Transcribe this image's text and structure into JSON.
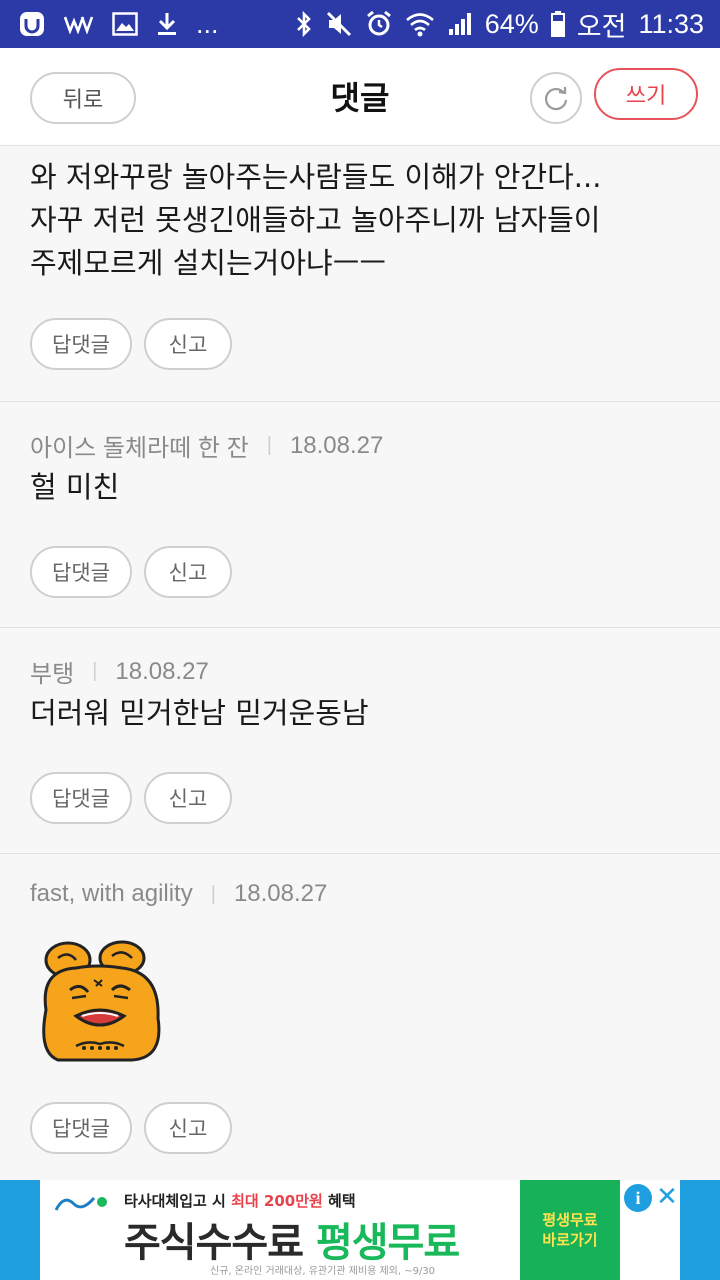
{
  "status_bar": {
    "battery": "64%",
    "ampm": "오전",
    "time": "11:33",
    "ellipsis": "..."
  },
  "header": {
    "back_label": "뒤로",
    "title": "댓글",
    "write_label": "쓰기"
  },
  "comments": [
    {
      "text_lines": [
        "와 저와꾸랑 놀아주는사람들도 이해가 안간다...",
        "자꾸 저런 못생긴애들하고 놀아주니까 남자들이",
        "주제모르게 설치는거아냐ㅡㅡ"
      ],
      "reply_label": "답댓글",
      "report_label": "신고"
    },
    {
      "author": "아이스 돌체라떼 한 잔",
      "date": "18.08.27",
      "text": "헐 미친",
      "reply_label": "답댓글",
      "report_label": "신고"
    },
    {
      "author": "부탱",
      "date": "18.08.27",
      "text": "더러워 믿거한남 믿거운동남",
      "reply_label": "답댓글",
      "report_label": "신고"
    },
    {
      "author": "fast, with agility",
      "date": "18.08.27",
      "reply_label": "답댓글",
      "report_label": "신고"
    }
  ],
  "ad": {
    "top_text_1": "타사대체입고 시",
    "top_text_2": "최대 200만원",
    "top_text_3": "혜택",
    "main_1": "주식수수료",
    "main_2": "평생무료",
    "cta_1": "평생무료",
    "cta_2": "바로가기",
    "fine_print": "신규, 온라인 거래대상, 유관기관 제비용 제외, ~9/30",
    "info_icon": "i",
    "close_icon": "✕"
  },
  "colors": {
    "status_bar": "#2b3aa7",
    "accent_red": "#e8434c",
    "ad_blue": "#1f9fe0",
    "ad_green": "#17b15a"
  }
}
